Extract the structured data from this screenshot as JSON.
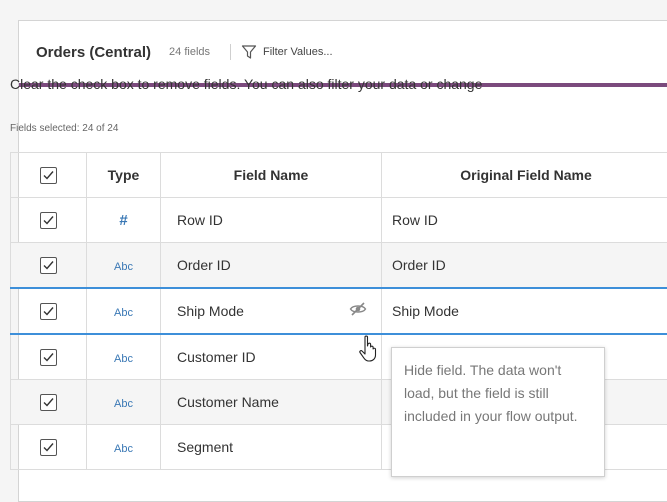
{
  "header": {
    "title": "Orders (Central)",
    "field_count": "24 fields",
    "filter_label": "Filter Values..."
  },
  "instructions": "Clear the check box to remove fields. You can also filter your data or change",
  "fields_selected": "Fields selected: 24 of 24",
  "columns": {
    "type": "Type",
    "field_name": "Field Name",
    "original_field_name": "Original Field Name"
  },
  "rows": [
    {
      "type_icon": "#",
      "type": "number",
      "field_name": "Row ID",
      "original": "Row ID",
      "checked": true
    },
    {
      "type_icon": "Abc",
      "type": "string",
      "field_name": "Order ID",
      "original": "Order ID",
      "checked": true
    },
    {
      "type_icon": "Abc",
      "type": "string",
      "field_name": "Ship Mode",
      "original": "Ship Mode",
      "checked": true
    },
    {
      "type_icon": "Abc",
      "type": "string",
      "field_name": "Customer ID",
      "original": "",
      "checked": true
    },
    {
      "type_icon": "Abc",
      "type": "string",
      "field_name": "Customer Name",
      "original": "",
      "checked": true
    },
    {
      "type_icon": "Abc",
      "type": "string",
      "field_name": "Segment",
      "original": "",
      "checked": true
    }
  ],
  "tooltip": "Hide field. The data won't load, but the field is still included in your flow output.",
  "colors": {
    "accent_bar": "#7b4a7d",
    "selected_row_border": "#3d8fd9",
    "type_icon": "#3a78b5"
  }
}
